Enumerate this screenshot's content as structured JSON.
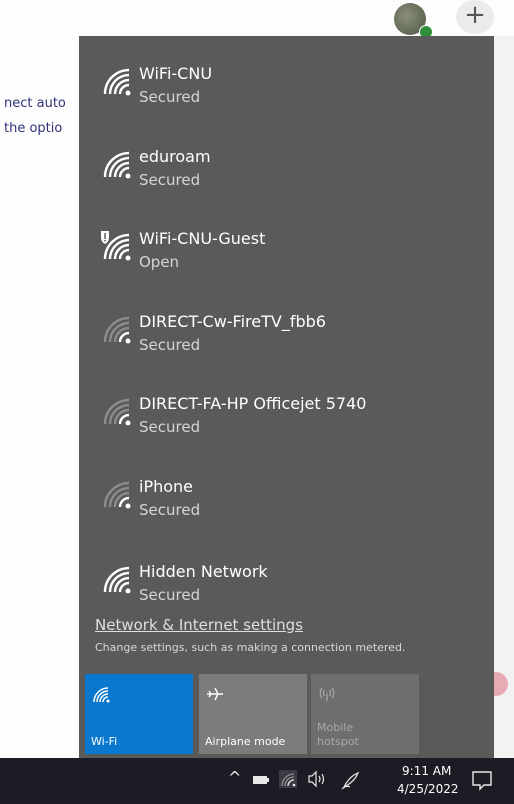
{
  "background": {
    "line1": "nect auto",
    "line2": "the optio",
    "plus_label": "+"
  },
  "networks": [
    {
      "name": "WiFi-CNU",
      "status": "Secured",
      "icon": "wifi-icon",
      "shield": false
    },
    {
      "name": "eduroam",
      "status": "Secured",
      "icon": "wifi-icon",
      "shield": false
    },
    {
      "name": "WiFi-CNU-Guest",
      "status": "Open",
      "icon": "wifi-open-icon",
      "shield": true
    },
    {
      "name": "DIRECT-Cw-FireTV_fbb6",
      "status": "Secured",
      "icon": "wifi-weak-icon",
      "shield": false
    },
    {
      "name": "DIRECT-FA-HP Officejet 5740",
      "status": "Secured",
      "icon": "wifi-weak-icon",
      "shield": false
    },
    {
      "name": "iPhone",
      "status": "Secured",
      "icon": "wifi-weak-icon",
      "shield": false
    },
    {
      "name": "Hidden Network",
      "status": "Secured",
      "icon": "wifi-icon",
      "shield": false
    }
  ],
  "settings": {
    "link": "Network & Internet settings",
    "description": "Change settings, such as making a connection metered."
  },
  "quick_actions": {
    "wifi": "Wi-Fi",
    "airplane": "Airplane mode",
    "hotspot_line1": "Mobile",
    "hotspot_line2": "hotspot"
  },
  "taskbar": {
    "time": "9:11 AM",
    "date": "4/25/2022",
    "chevron": "^"
  },
  "colors": {
    "flyout_bg": "#5a5a5a",
    "accent": "#0b78d0",
    "taskbar": "#1c1c24"
  }
}
